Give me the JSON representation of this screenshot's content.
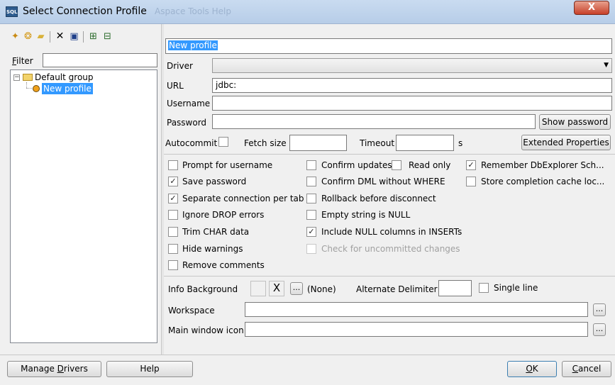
{
  "window": {
    "title": "Select Connection Profile",
    "ghost_text": "Aspace  Tools  Help",
    "close_label": "X",
    "app_icon_text": "SQL"
  },
  "left": {
    "filter_label": "Filter",
    "filter_value": "",
    "toolbar_icons": [
      "new-profile-icon",
      "new-profile-copy-icon",
      "new-group-icon",
      "delete-icon",
      "save-icon",
      "expand-all-icon",
      "collapse-all-icon"
    ],
    "tree": {
      "group": "Default group",
      "profile": "New profile"
    }
  },
  "profile": {
    "name": "New profile",
    "driver_label": "Driver",
    "driver_value": "",
    "url_label": "URL",
    "url_value": "jdbc:",
    "username_label": "Username",
    "username_value": "",
    "password_label": "Password",
    "password_value": "",
    "show_password_label": "Show password",
    "autocommit_label": "Autocommit",
    "fetch_size_label": "Fetch size",
    "fetch_size_value": "",
    "timeout_label": "Timeout",
    "timeout_value": "",
    "timeout_unit": "s",
    "extended_properties_label": "Extended Properties"
  },
  "options": {
    "col1": [
      {
        "label": "Prompt for username",
        "checked": false
      },
      {
        "label": "Save password",
        "checked": true
      },
      {
        "label": "Separate connection per tab",
        "checked": true
      },
      {
        "label": "Ignore DROP errors",
        "checked": false
      },
      {
        "label": "Trim CHAR data",
        "checked": false
      },
      {
        "label": "Hide warnings",
        "checked": false
      },
      {
        "label": "Remove comments",
        "checked": false
      }
    ],
    "col2": [
      {
        "label": "Confirm updates",
        "checked": false
      },
      {
        "label": "Confirm DML without WHERE",
        "checked": false
      },
      {
        "label": "Rollback before disconnect",
        "checked": false
      },
      {
        "label": "Empty string is NULL",
        "checked": false
      },
      {
        "label": "Include NULL columns in INSERTs",
        "checked": true
      },
      {
        "label": "Check for uncommitted changes",
        "checked": false,
        "disabled": true
      }
    ],
    "read_only": {
      "label": "Read only",
      "checked": false
    },
    "col3": [
      {
        "label": "Remember DbExplorer Sch...",
        "checked": true
      },
      {
        "label": "Store completion cache loc...",
        "checked": false
      }
    ]
  },
  "misc": {
    "info_background_label": "Info Background",
    "info_background_value": "(None)",
    "alternate_delimiter_label": "Alternate Delimiter",
    "alternate_delimiter_value": "",
    "single_line_label": "Single line",
    "workspace_label": "Workspace",
    "workspace_value": "",
    "main_window_icon_label": "Main window icon",
    "main_window_icon_value": "",
    "browse_label": "...",
    "clear_label": "X"
  },
  "footer": {
    "manage_drivers_label": "Manage Drivers",
    "help_label": "Help",
    "ok_label": "OK",
    "cancel_label": "Cancel"
  }
}
